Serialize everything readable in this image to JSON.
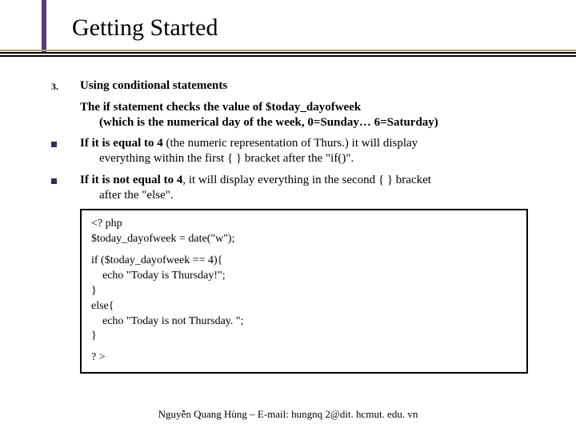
{
  "title": "Getting Started",
  "list_number": "3.",
  "section_title": "Using conditional statements",
  "intro": {
    "line1_a": "The if statement checks the value of ",
    "line1_b": "$today_dayofweek",
    "line2": "(which is the numerical day of the week, 0=Sunday… 6=Saturday)"
  },
  "bullet1": {
    "b": "If it is equal to 4",
    "rest1": " (the numeric representation of Thurs.) it will display ",
    "rest2": "everything within the first { } bracket after the \"if()\"."
  },
  "bullet2": {
    "b": "If it is not equal to 4",
    "rest1": ", it will display everything in the second { } bracket ",
    "rest2": "after the \"else\"."
  },
  "code": {
    "l1": "<? php",
    "l2": "$today_dayofweek = date(\"w\");",
    "l3": "if ($today_dayofweek == 4){",
    "l4": "    echo \"Today is Thursday!\";",
    "l5": "}",
    "l6": "else{",
    "l7": "    echo \"Today is not Thursday. \";",
    "l8": "}",
    "l9": "? >"
  },
  "footer": "Nguyễn Quang Hùng – E-mail: hungnq 2@dit. hcmut. edu. vn"
}
